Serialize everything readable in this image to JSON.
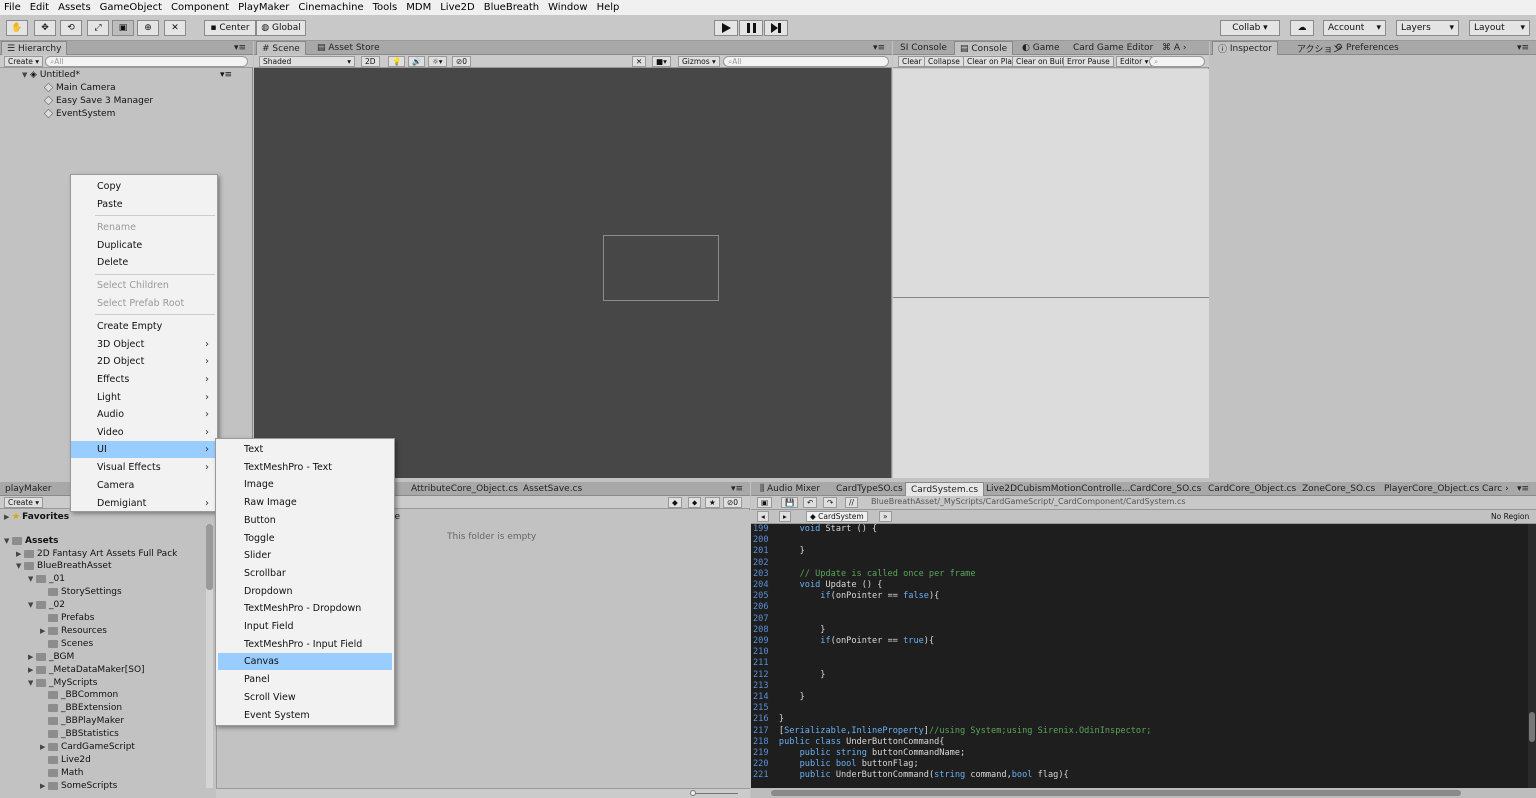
{
  "menubar": [
    "File",
    "Edit",
    "Assets",
    "GameObject",
    "Component",
    "PlayMaker",
    "Cinemachine",
    "Tools",
    "MDM",
    "Live2D",
    "BlueBreath",
    "Window",
    "Help"
  ],
  "toolbar": {
    "center": "Center",
    "global": "Global",
    "collab": "Collab",
    "account": "Account",
    "layers": "Layers",
    "layout": "Layout"
  },
  "hierarchy": {
    "tab": "Hierarchy",
    "create": "Create",
    "search": "All",
    "scene": "Untitled*",
    "items": [
      "Main Camera",
      "Easy Save 3 Manager",
      "EventSystem"
    ]
  },
  "scene": {
    "tabs": [
      "Scene",
      "Asset Store"
    ],
    "shaded": "Shaded",
    "mode2d": "2D",
    "gizmos": "Gizmos",
    "search": "All"
  },
  "console": {
    "tabs": [
      "SI Console",
      "Console",
      "Game",
      "Card Game Editor",
      "A"
    ],
    "buttons": [
      "Clear",
      "Collapse",
      "Clear on Play",
      "Clear on Build",
      "Error Pause",
      "Editor"
    ]
  },
  "inspector": {
    "tabs": [
      "Inspector",
      "アクション",
      "Preferences"
    ]
  },
  "context_menu": {
    "items": [
      {
        "label": "Copy",
        "disabled": false
      },
      {
        "label": "Paste",
        "disabled": false
      },
      {
        "label": "Rename",
        "disabled": true
      },
      {
        "label": "Duplicate",
        "disabled": false
      },
      {
        "label": "Delete",
        "disabled": false
      },
      {
        "label": "Select Children",
        "disabled": true
      },
      {
        "label": "Select Prefab Root",
        "disabled": true
      },
      {
        "label": "Create Empty",
        "disabled": false
      },
      {
        "label": "3D Object",
        "disabled": false
      },
      {
        "label": "2D Object",
        "disabled": false
      },
      {
        "label": "Effects",
        "disabled": false
      },
      {
        "label": "Light",
        "disabled": false
      },
      {
        "label": "Audio",
        "disabled": false
      },
      {
        "label": "Video",
        "disabled": false
      },
      {
        "label": "UI",
        "disabled": false
      },
      {
        "label": "Visual Effects",
        "disabled": false
      },
      {
        "label": "Camera",
        "disabled": false
      },
      {
        "label": "Demigiant",
        "disabled": false
      }
    ]
  },
  "ui_submenu": {
    "items": [
      "Text",
      "TextMeshPro - Text",
      "Image",
      "Raw Image",
      "Button",
      "Toggle",
      "Slider",
      "Scrollbar",
      "Dropdown",
      "TextMeshPro - Dropdown",
      "Input Field",
      "TextMeshPro - Input Field",
      "Canvas",
      "Panel",
      "Scroll View",
      "Event System"
    ],
    "highlighted": "Canvas"
  },
  "project": {
    "tab": "playMaker",
    "create": "Create",
    "favorites": "Favorites",
    "assets": "Assets",
    "tree": [
      {
        "label": "2D Fantasy Art Assets Full Pack",
        "depth": 1
      },
      {
        "label": "BlueBreathAsset",
        "depth": 1
      },
      {
        "label": "_01",
        "depth": 2
      },
      {
        "label": "StorySettings",
        "depth": 3
      },
      {
        "label": "_02",
        "depth": 2
      },
      {
        "label": "Prefabs",
        "depth": 3
      },
      {
        "label": "Resources",
        "depth": 3
      },
      {
        "label": "Scenes",
        "depth": 3
      },
      {
        "label": "_BGM",
        "depth": 2
      },
      {
        "label": "_MetaDataMaker[SO]",
        "depth": 2
      },
      {
        "label": "_MyScripts",
        "depth": 2
      },
      {
        "label": "_BBCommon",
        "depth": 3
      },
      {
        "label": "_BBExtension",
        "depth": 3
      },
      {
        "label": "_BBPlayMaker",
        "depth": 3
      },
      {
        "label": "_BBStatistics",
        "depth": 3
      },
      {
        "label": "CardGameScript",
        "depth": 3
      },
      {
        "label": "Live2d",
        "depth": 3
      },
      {
        "label": "Math",
        "depth": 3
      },
      {
        "label": "SomeScripts",
        "depth": 3
      }
    ],
    "empty": "This folder is empty",
    "file_tabs": [
      "AttributeCore_Object.cs",
      "AssetSave.cs"
    ]
  },
  "editor": {
    "tabs": [
      "Audio Mixer",
      "CardTypeSO.cs",
      "CardSystem.cs",
      "Live2DCubismMotionControlle...",
      "CardCore_SO.cs",
      "CardCore_Object.cs",
      "ZoneCore_SO.cs",
      "PlayerCore_Object.cs",
      "Carc"
    ],
    "path": "BlueBreathAsset/_MyScripts/CardGameScript/_CardComponent/CardSystem.cs",
    "class_tab": "CardSystem",
    "region": "No Region",
    "lines": [
      {
        "n": "199",
        "t": "    void Start () {"
      },
      {
        "n": "200",
        "t": ""
      },
      {
        "n": "201",
        "t": "    }"
      },
      {
        "n": "202",
        "t": ""
      },
      {
        "n": "203",
        "t": "    // Update is called once per frame"
      },
      {
        "n": "204",
        "t": "    void Update () {"
      },
      {
        "n": "205",
        "t": "        if(onPointer == false){"
      },
      {
        "n": "206",
        "t": ""
      },
      {
        "n": "207",
        "t": ""
      },
      {
        "n": "208",
        "t": "        }"
      },
      {
        "n": "209",
        "t": "        if(onPointer == true){"
      },
      {
        "n": "210",
        "t": ""
      },
      {
        "n": "211",
        "t": ""
      },
      {
        "n": "212",
        "t": "        }"
      },
      {
        "n": "213",
        "t": ""
      },
      {
        "n": "214",
        "t": "    }"
      },
      {
        "n": "215",
        "t": ""
      },
      {
        "n": "216",
        "t": "}"
      },
      {
        "n": "217",
        "t": "[Serializable,InlineProperty]//using System;using Sirenix.OdinInspector;"
      },
      {
        "n": "218",
        "t": "public class UnderButtonCommand{"
      },
      {
        "n": "219",
        "t": "    public string buttonCommandName;"
      },
      {
        "n": "220",
        "t": "    public bool buttonFlag;"
      },
      {
        "n": "221",
        "t": "    public UnderButtonCommand(string command,bool flag){"
      }
    ]
  }
}
